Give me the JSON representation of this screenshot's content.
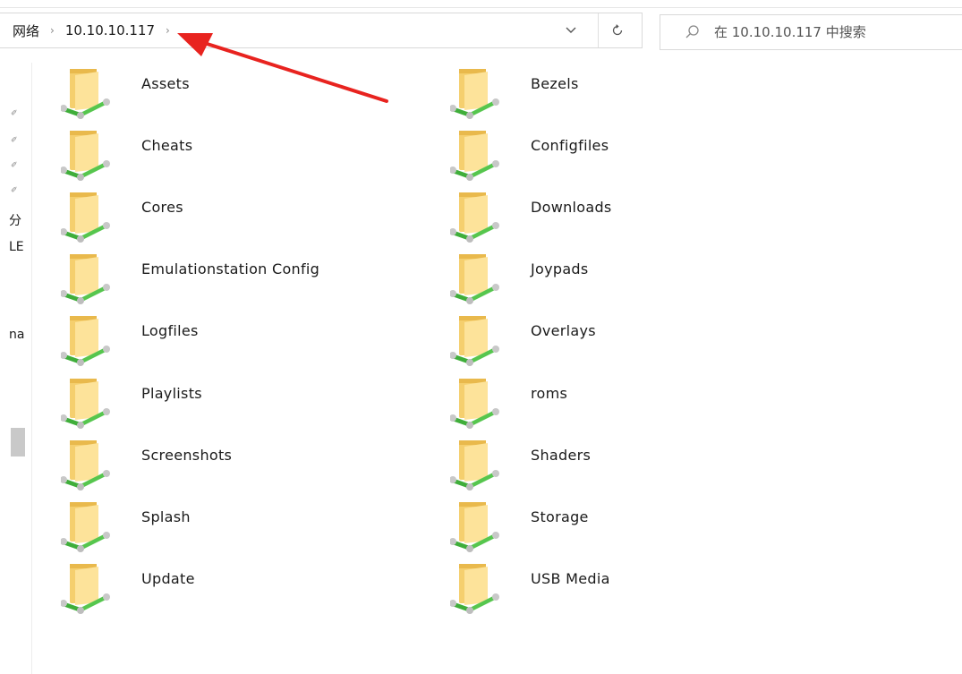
{
  "breadcrumb": {
    "items": [
      "网络",
      "10.10.10.117"
    ]
  },
  "search": {
    "placeholder": "在 10.10.10.117 中搜索"
  },
  "nav_pane": {
    "texts": [
      "分",
      "LE",
      "na"
    ]
  },
  "folders": {
    "left": [
      "Assets",
      "Cheats",
      "Cores",
      "Emulationstation Config",
      "Logfiles",
      "Playlists",
      "Screenshots",
      "Splash",
      "Update"
    ],
    "right": [
      "Bezels",
      "Configfiles",
      "Downloads",
      "Joypads",
      "Overlays",
      "roms",
      "Shaders",
      "Storage",
      "USB Media"
    ]
  },
  "icons": {
    "dropdown": "chevron-down-icon",
    "refresh": "refresh-icon",
    "search": "search-icon",
    "folder": "network-folder-icon",
    "pin": "pin-icon"
  },
  "colors": {
    "folder_body": "#f5cf6e",
    "folder_front": "#fde39a",
    "network_green": "#3fae3a",
    "annotation_arrow": "#e8231f"
  }
}
